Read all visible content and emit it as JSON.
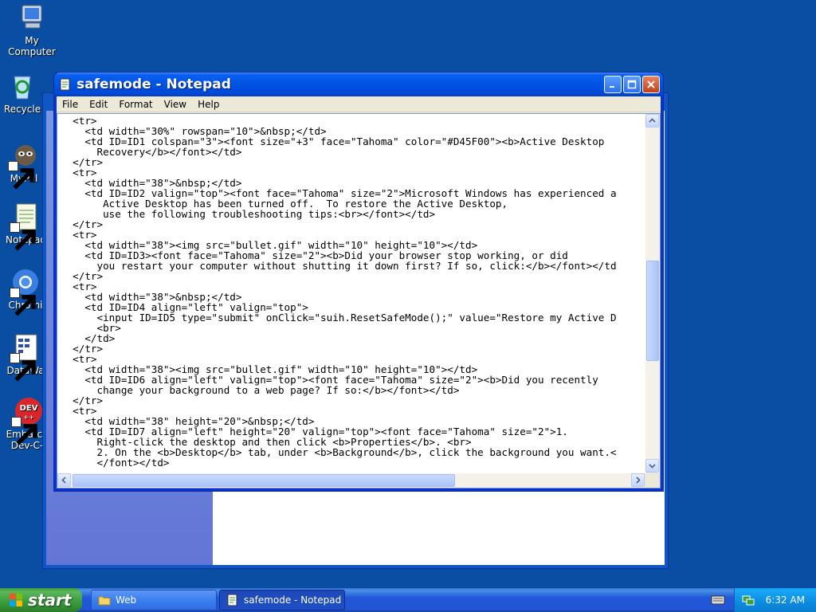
{
  "desktop": {
    "icons": [
      {
        "label": "My\nComputer",
        "icon": "my-computer-icon"
      },
      {
        "label": "Recycle",
        "icon": "recycle-bin-icon"
      },
      {
        "label": "MyPal",
        "icon": "mypal-icon"
      },
      {
        "label": "Notepac",
        "icon": "notepad-icon"
      },
      {
        "label": "Chromi",
        "icon": "chromium-icon"
      },
      {
        "label": "DataWa",
        "icon": "datawarrior-icon"
      },
      {
        "label": "Embarca\nDev-C-",
        "icon": "dev-cpp-icon"
      }
    ]
  },
  "notepad": {
    "title": "safemode - Notepad",
    "menu": [
      "File",
      "Edit",
      "Format",
      "View",
      "Help"
    ],
    "lines": [
      "  <tr>",
      "    <td width=\"30%\" rowspan=\"10\">&nbsp;</td>",
      "    <td ID=ID1 colspan=\"3\"><font size=\"+3\" face=\"Tahoma\" color=\"#D45F00\"><b>Active Desktop",
      "      Recovery</b></font></td>",
      "  </tr>",
      "  <tr>",
      "    <td width=\"38\">&nbsp;</td>",
      "    <td ID=ID2 valign=\"top\"><font face=\"Tahoma\" size=\"2\">Microsoft Windows has experienced a",
      "       Active Desktop has been turned off.  To restore the Active Desktop,",
      "       use the following troubleshooting tips:<br></font></td>",
      "  </tr>",
      "  <tr>",
      "    <td width=\"38\"><img src=\"bullet.gif\" width=\"10\" height=\"10\"></td>",
      "    <td ID=ID3><font face=\"Tahoma\" size=\"2\"><b>Did your browser stop working, or did",
      "      you restart your computer without shutting it down first? If so, click:</b></font></td",
      "  </tr>",
      "  <tr>",
      "    <td width=\"38\">&nbsp;</td>",
      "    <td ID=ID4 align=\"left\" valign=\"top\">",
      "      <input ID=ID5 type=\"submit\" onClick=\"suih.ResetSafeMode();\" value=\"Restore my Active D",
      "      <br>",
      "    </td>",
      "  </tr>",
      "  <tr>",
      "    <td width=\"38\"><img src=\"bullet.gif\" width=\"10\" height=\"10\"></td>",
      "    <td ID=ID6 align=\"left\" valign=\"top\"><font face=\"Tahoma\" size=\"2\"><b>Did you recently",
      "      change your background to a web page? If so:</b></font></td>",
      "  </tr>",
      "  <tr>",
      "    <td width=\"38\" height=\"20\">&nbsp;</td>",
      "    <td ID=ID7 align=\"left\" height=\"20\" valign=\"top\"><font face=\"Tahoma\" size=\"2\">1.",
      "      Right-click the desktop and then click <b>Properties</b>. <br>",
      "      2. On the <b>Desktop</b> tab, under <b>Background</b>, click the background you want.<",
      "      </font></td>"
    ]
  },
  "taskbar": {
    "start_label": "start",
    "tasks": [
      {
        "label": "Web",
        "icon": "folder-icon",
        "active": false
      },
      {
        "label": "safemode - Notepad",
        "icon": "notepad-icon",
        "active": true
      }
    ],
    "clock": "6:32 AM"
  }
}
